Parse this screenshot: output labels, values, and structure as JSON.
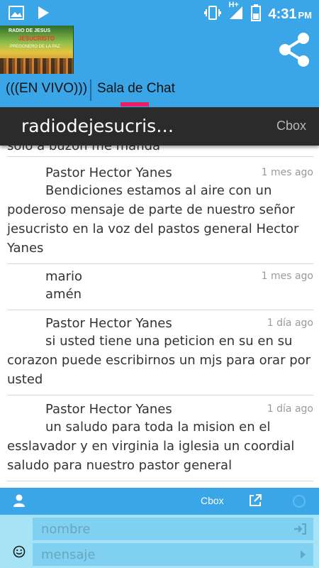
{
  "status_bar": {
    "time": "4:31",
    "ampm": "PM",
    "network": "H+",
    "icons": [
      "image-icon",
      "play-icon",
      "vibrate-icon",
      "signal-icon",
      "battery-icon"
    ]
  },
  "app_bar": {
    "logo_lines": [
      "RADIO DE JESUS",
      "JESUCRISTO",
      "PREGONERO DE LA PAZ"
    ],
    "share_icon": "share-icon"
  },
  "tabs": [
    {
      "label": "(((EN VIVO)))",
      "active": false
    },
    {
      "label": "Sala de Chat",
      "active": true
    }
  ],
  "chat": {
    "title": "radiodejesucris…",
    "brand": "Cbox",
    "partial_text": "solo a buzón me manda",
    "messages": [
      {
        "author": "Pastor Hector Yanes",
        "time": "1 mes ago",
        "text": "Bendiciones estamos al aire con un poderoso mensaje de parte de nuestro señor jesucristo en la voz del pastos general Hector Yanes"
      },
      {
        "author": "mario",
        "time": "1 mes ago",
        "text": "amén"
      },
      {
        "author": "Pastor Hector Yanes",
        "time": "1 día ago",
        "text": "si usted tiene una peticion en su en su corazon puede escribirnos un mjs para orar por usted"
      },
      {
        "author": "Pastor Hector Yanes",
        "time": "1 día ago",
        "text": "un saludo para toda la mision en el esslavador y en virginia la iglesia un coordial saludo para nuestro pastor general"
      }
    ]
  },
  "bottom_bar": {
    "brand": "Cbox"
  },
  "form": {
    "name_placeholder": "nombre",
    "message_placeholder": "mensaje"
  },
  "colors": {
    "accent": "#3aa6e8",
    "tab_indicator": "#e91e63",
    "header_dark": "#2b2b2b",
    "input_bg": "#a6e3f7"
  }
}
